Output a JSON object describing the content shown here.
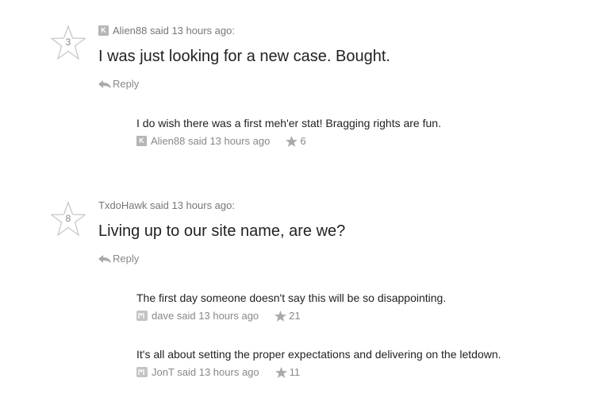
{
  "comments": [
    {
      "score": "3",
      "author_meta": "Alien88 said 13 hours ago:",
      "text": "I was just looking for a new case. Bought.",
      "reply_label": "Reply",
      "replies": [
        {
          "text": "I do wish there was a first meh'er stat! Bragging rights are fun.",
          "meta": "Alien88 said 13 hours ago",
          "votes": "6"
        }
      ]
    },
    {
      "score": "8",
      "author_meta": "TxdoHawk said 13 hours ago:",
      "text": "Living up to our site name, are we?",
      "reply_label": "Reply",
      "replies": [
        {
          "text": "The first day someone doesn't say this will be so disappointing.",
          "meta": "dave said 13 hours ago",
          "votes": "21"
        },
        {
          "text": "It's all about setting the proper expectations and delivering on the letdown.",
          "meta": "JonT said 13 hours ago",
          "votes": "11"
        }
      ]
    }
  ],
  "badges": {
    "k_letter": "K"
  },
  "colors": {
    "star_outline": "#c8c8c8",
    "vote_star": "#aaaaaa",
    "meta_text": "#777777"
  }
}
